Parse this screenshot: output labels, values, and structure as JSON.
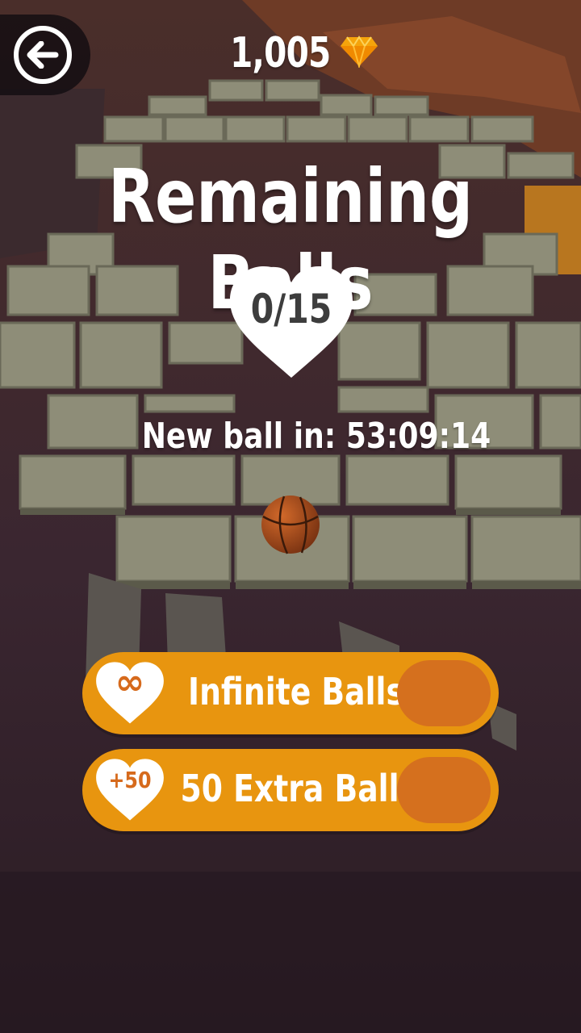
{
  "header": {
    "gem_count": "1,005",
    "gem_icon": "diamond-icon",
    "back_icon": "arrow-left-icon"
  },
  "main": {
    "title": "Remaining Balls",
    "balls_counter": "0/15",
    "timer_text": "New ball in: 53:09:14"
  },
  "offers": [
    {
      "icon": "infinity-icon",
      "icon_text": "∞",
      "label": "Infinite Balls"
    },
    {
      "icon": "plus-fifty-icon",
      "icon_text": "+50",
      "label": "50 Extra Balls"
    }
  ],
  "colors": {
    "accent": "#e8950f",
    "accent_dark": "#d5701e",
    "tile": "#8e8d78",
    "background": "#2c1f28"
  }
}
